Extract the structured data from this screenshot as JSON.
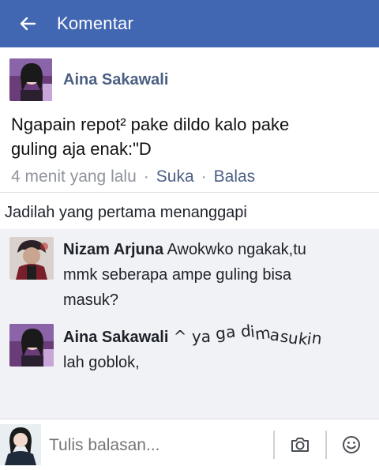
{
  "header": {
    "title": "Komentar",
    "back_icon": "back-arrow-icon"
  },
  "post": {
    "author": "Aina Sakawali",
    "text_line1": "Ngapain repot² pake dildo kalo pake",
    "text_line2": "guling aja enak:\"D",
    "time": "4 menit yang lalu",
    "separator": "·",
    "like_label": "Suka",
    "reply_label": "Balas"
  },
  "first_reply_prompt": "Jadilah yang pertama menanggapi",
  "replies": [
    {
      "author": "Nizam Arjuna",
      "text_line1_rest": " Awokwko ngakak,tu",
      "text_line2": "mmk seberapa ampe guling bisa",
      "text_line3": "masuk?"
    },
    {
      "author": "Aina Sakawali",
      "text_line1_rest": " ^ ya ga dimasukin",
      "text_line2": "lah goblok,"
    }
  ],
  "composer": {
    "placeholder": "Tulis balasan...",
    "camera_icon": "camera-icon",
    "emoji_icon": "emoji-icon"
  },
  "colors": {
    "header_bg": "#4267b2",
    "author_link": "#4b5f83",
    "meta_gray": "#90949c",
    "replies_bg": "#f1f2f5"
  }
}
